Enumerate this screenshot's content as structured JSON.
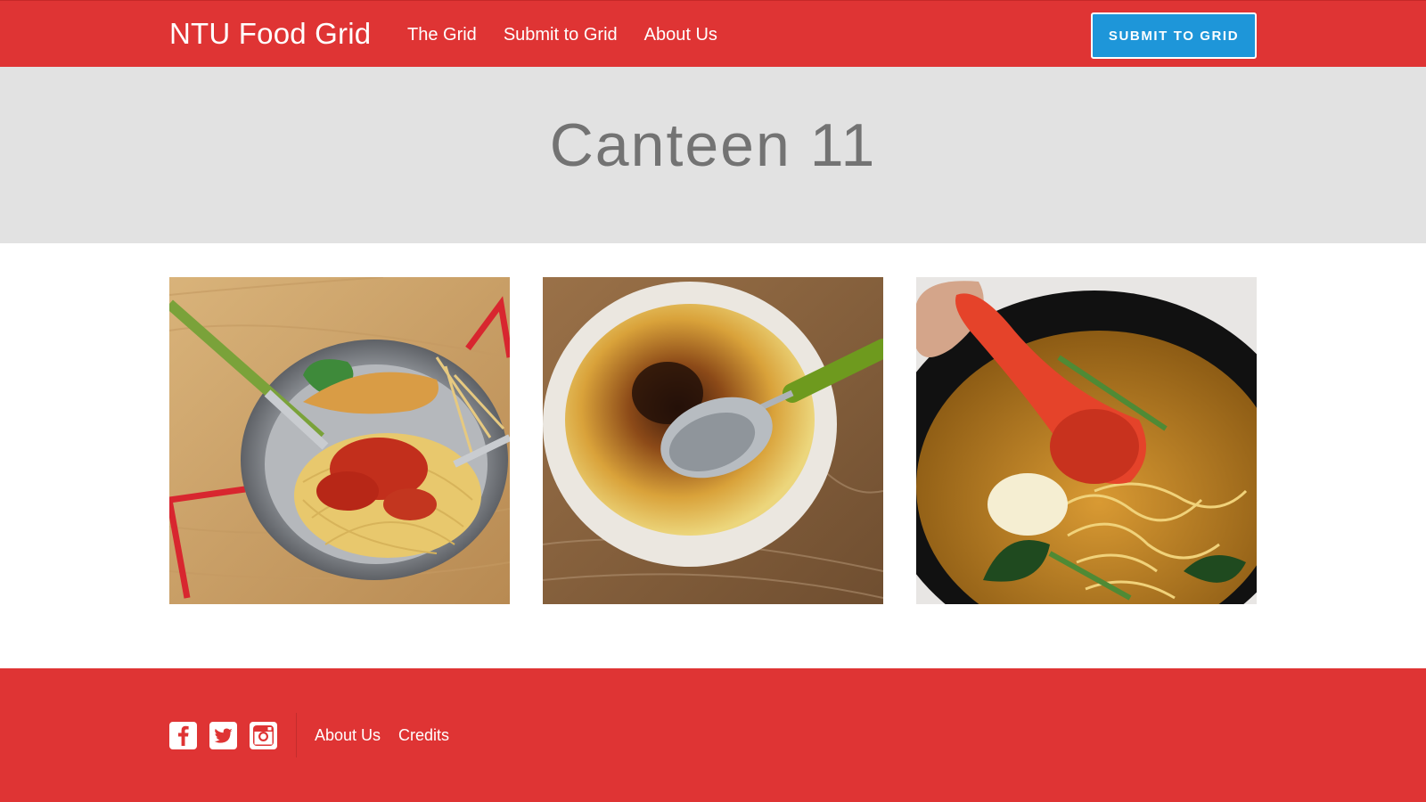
{
  "navbar": {
    "brand": "NTU Food Grid",
    "links": [
      {
        "label": "The Grid"
      },
      {
        "label": "Submit to Grid"
      },
      {
        "label": "About Us"
      }
    ],
    "cta_label": "SUBMIT TO GRID",
    "background_color": "#df3434",
    "cta_color": "#1e96d9"
  },
  "hero": {
    "title": "Canteen 11",
    "background_color": "#e2e2e2"
  },
  "grid": {
    "tiles": [
      {
        "icon": "pasta-photo"
      },
      {
        "icon": "creme-brulee-photo"
      },
      {
        "icon": "noodle-soup-photo"
      }
    ]
  },
  "footer": {
    "social_icons": [
      "facebook-icon",
      "twitter-icon",
      "instagram-icon"
    ],
    "links": [
      {
        "label": "About Us"
      },
      {
        "label": "Credits"
      }
    ]
  }
}
